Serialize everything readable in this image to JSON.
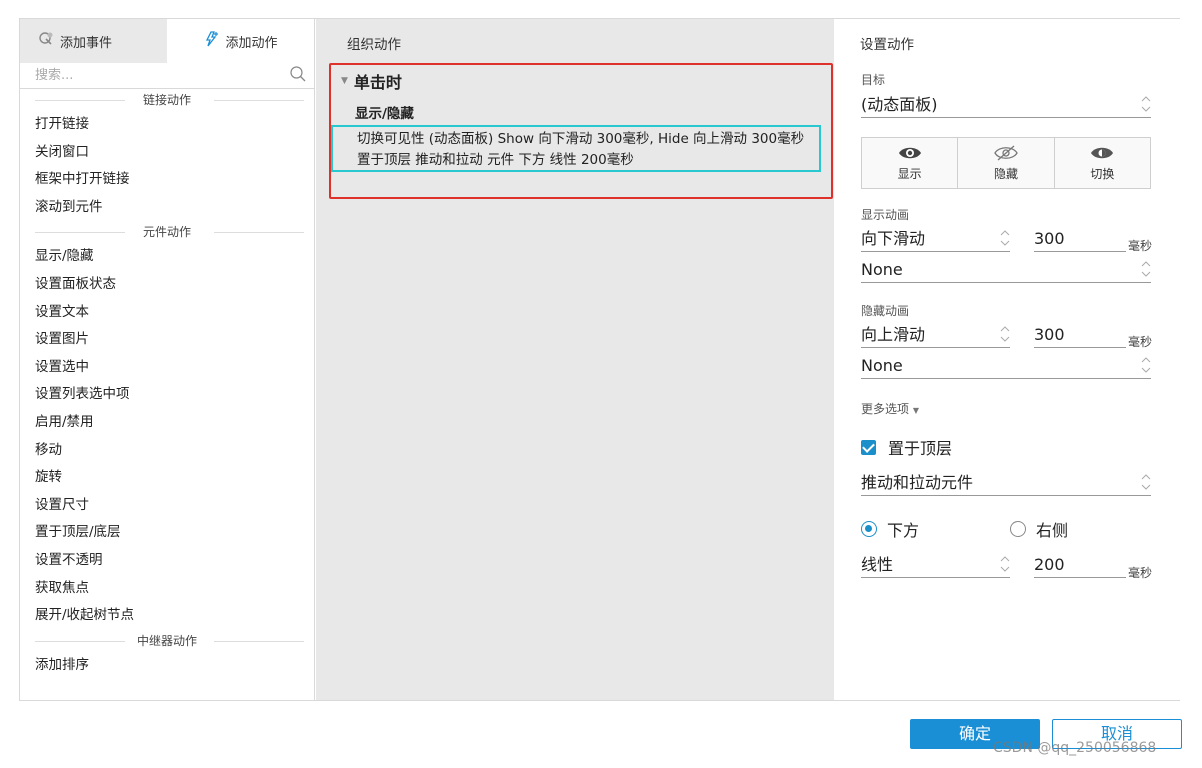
{
  "left_panel": {
    "tabs": [
      {
        "label": "添加事件",
        "icon": "add-event-icon"
      },
      {
        "label": "添加动作",
        "icon": "add-action-icon"
      }
    ],
    "search_placeholder": "搜索...",
    "groups": [
      {
        "title": "链接动作",
        "items": [
          "打开链接",
          "关闭窗口",
          "框架中打开链接",
          "滚动到元件"
        ]
      },
      {
        "title": "元件动作",
        "items": [
          "显示/隐藏",
          "设置面板状态",
          "设置文本",
          "设置图片",
          "设置选中",
          "设置列表选中项",
          "启用/禁用",
          "移动",
          "旋转",
          "设置尺寸",
          "置于顶层/底层",
          "设置不透明",
          "获取焦点",
          "展开/收起树节点"
        ]
      },
      {
        "title": "中继器动作",
        "items": [
          "添加排序"
        ]
      }
    ]
  },
  "middle_panel": {
    "title": "组织动作",
    "event": "单击时",
    "action_type": "显示/隐藏",
    "action_desc": "切换可见性 (动态面板) Show 向下滑动 300毫秒, Hide 向上滑动 300毫秒 置于顶层 推动和拉动 元件 下方 线性 200毫秒"
  },
  "right_panel": {
    "title": "设置动作",
    "target_label": "目标",
    "target_value": "(动态面板)",
    "visibility_buttons": [
      {
        "label": "显示",
        "icon": "eye-icon"
      },
      {
        "label": "隐藏",
        "icon": "eye-slash-icon"
      },
      {
        "label": "切换",
        "icon": "eye-toggle-icon"
      }
    ],
    "show_anim_label": "显示动画",
    "show_anim": "向下滑动",
    "show_duration": "300",
    "show_unit": "毫秒",
    "show_easing": "None",
    "hide_anim_label": "隐藏动画",
    "hide_anim": "向上滑动",
    "hide_duration": "300",
    "hide_unit": "毫秒",
    "hide_easing": "None",
    "more_options": "更多选项",
    "bring_to_front_label": "置于顶层",
    "bring_to_front_checked": true,
    "push_pull": "推动和拉动元件",
    "direction_below": "下方",
    "direction_right": "右侧",
    "direction_selected": "下方",
    "push_easing": "线性",
    "push_duration": "200",
    "push_unit": "毫秒"
  },
  "footer": {
    "ok_label": "确定",
    "cancel_label": "取消"
  },
  "watermark": "CSDN @qq_250056868",
  "colors": {
    "accent": "#1a8fd6",
    "highlight_red": "#e0302a",
    "highlight_cyan": "#27c8d0",
    "middle_bg": "#e8e8e8"
  }
}
